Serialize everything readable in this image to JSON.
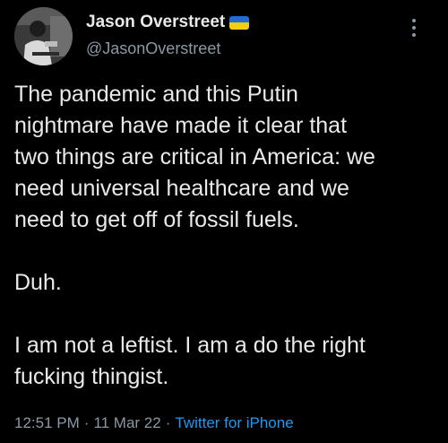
{
  "tweet": {
    "display_name": "Jason Overstreet",
    "flag_icon": "ukraine-flag-icon",
    "flag_colors": [
      "#1d6fd6",
      "#f6cd11"
    ],
    "handle": "@JasonOverstreet",
    "more_icon": "more-vertical-icon",
    "text_lines": {
      "p1_l1": "The pandemic and this Putin",
      "p1_l2": "nightmare have made it clear that",
      "p1_l3": "two things are critical in America: we",
      "p1_l4": "need universal healthcare and we",
      "p1_l5": "need to get off of fossil fuels.",
      "p2_l1": "Duh.",
      "p3_l1": "I am not a leftist. I am a do the right",
      "p3_l2": "fucking thingist."
    },
    "time": "12:51 PM",
    "separator": "·",
    "date": "11 Mar 22",
    "source": "Twitter for iPhone"
  },
  "colors": {
    "background": "#000000",
    "primary_text": "#e7e9ea",
    "secondary_text": "#8b98a5",
    "link": "#1d9bf0"
  }
}
